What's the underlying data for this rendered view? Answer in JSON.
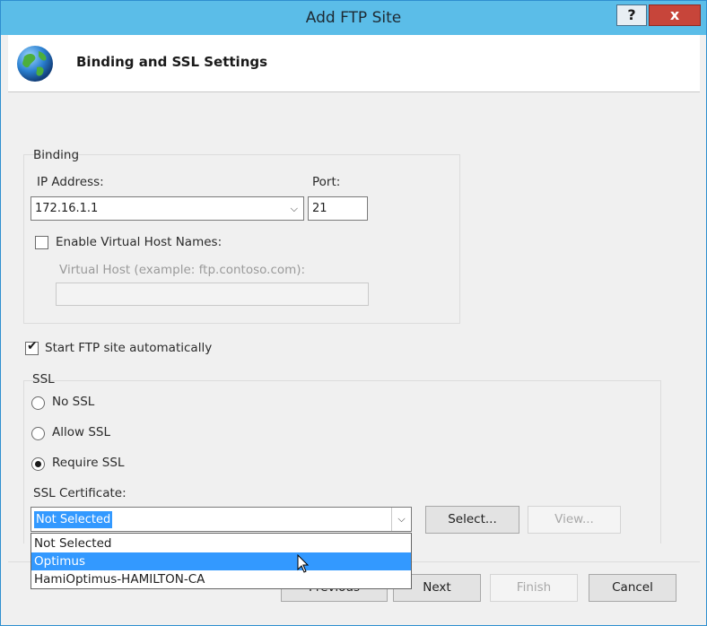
{
  "window": {
    "title": "Add FTP Site",
    "help_label": "?",
    "close_label": "x"
  },
  "header": {
    "title": "Binding and SSL Settings",
    "icon": "globe-icon"
  },
  "binding": {
    "group_label": "Binding",
    "ip_label": "IP Address:",
    "ip_value": "172.16.1.1",
    "port_label": "Port:",
    "port_value": "21",
    "virtual_host_checkbox_label": "Enable Virtual Host Names:",
    "virtual_host_checked": false,
    "virtual_host_label": "Virtual Host (example: ftp.contoso.com):",
    "virtual_host_value": ""
  },
  "start_auto": {
    "label": "Start FTP site automatically",
    "checked": true
  },
  "ssl": {
    "group_label": "SSL",
    "options": [
      {
        "label": "No SSL",
        "selected": false
      },
      {
        "label": "Allow SSL",
        "selected": false
      },
      {
        "label": "Require SSL",
        "selected": true
      }
    ],
    "certificate_label": "SSL Certificate:",
    "certificate_value": "Not Selected",
    "certificate_options": [
      "Not Selected",
      "Optimus",
      "HamiOptimus-HAMILTON-CA"
    ],
    "hovered_option": "Optimus",
    "select_button": "Select...",
    "view_button": "View..."
  },
  "footer": {
    "previous_button": "Previous",
    "next_button": "Next",
    "finish_button": "Finish",
    "cancel_button": "Cancel"
  },
  "colors": {
    "titlebar": "#5bbde8",
    "selection": "#3399ff",
    "close": "#c7453a"
  }
}
